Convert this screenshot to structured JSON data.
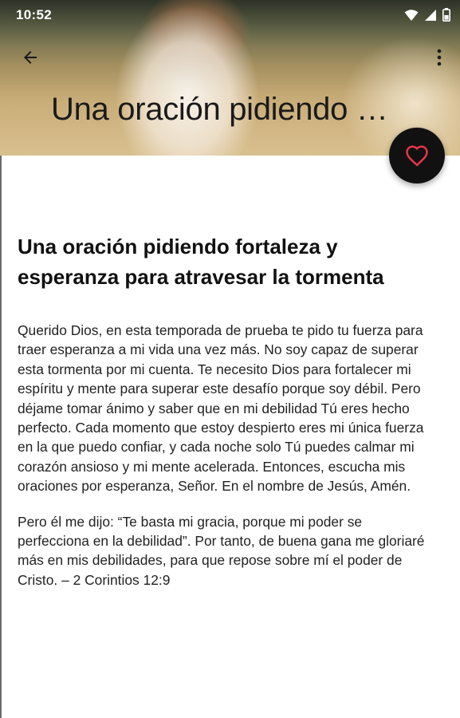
{
  "status_bar": {
    "time": "10:52",
    "icons": [
      "wifi-icon",
      "signal-icon",
      "battery-icon"
    ]
  },
  "toolbar": {
    "back_icon": "arrow-left-icon",
    "more_icon": "more-vertical-icon",
    "collapsed_title": "Una oración pidiendo fortaleza y esperanza para atravesar la tormenta"
  },
  "fab": {
    "icon": "heart-outline-icon",
    "icon_color": "#e8354a",
    "background": "#111111"
  },
  "article": {
    "title": "Una oración pidiendo fortaleza y esperanza para atravesar la tormenta",
    "body": "Querido Dios, en esta temporada de prueba te pido tu fuerza para traer esperanza a mi vida una vez más. No soy capaz de superar esta tormenta por mi cuenta. Te necesito Dios para fortalecer mi espíritu y mente para superar este desafío porque soy débil. Pero déjame tomar ánimo y saber que en mi debilidad Tú eres hecho perfecto. Cada momento que estoy despierto eres mi única fuerza en la que puedo confiar, y cada noche solo Tú puedes calmar mi corazón ansioso y mi mente acelerada. Entonces, escucha mis oraciones por esperanza, Señor. En el nombre de Jesús, Amén.",
    "verse": "Pero él me dijo: “Te basta mi gracia, porque mi poder se perfecciona en la debilidad”. Por tanto, de buena gana me gloriaré más en mis debilidades, para que repose sobre mí el poder de Cristo. – 2 Corintios 12:9"
  }
}
